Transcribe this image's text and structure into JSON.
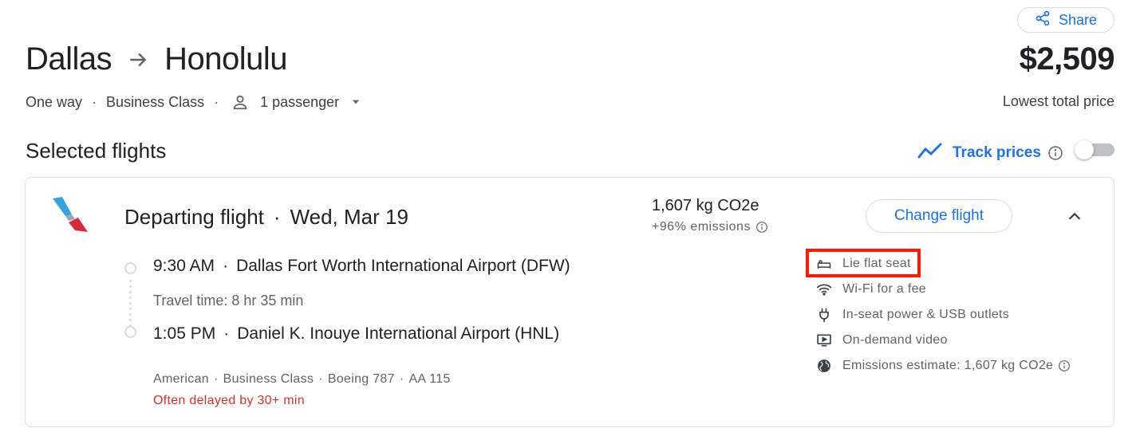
{
  "header": {
    "origin": "Dallas",
    "destination": "Honolulu",
    "share_label": "Share",
    "price": "$2,509",
    "price_caption": "Lowest total price",
    "trip_type": "One way",
    "cabin_class": "Business Class",
    "passengers": "1 passenger"
  },
  "selected": {
    "title": "Selected flights",
    "track_prices_label": "Track prices",
    "track_prices_enabled": false
  },
  "flight": {
    "direction": "Departing flight",
    "date": "Wed, Mar 19",
    "emissions_amount": "1,607 kg CO2e",
    "emissions_delta": "+96% emissions",
    "change_label": "Change flight",
    "departure_time": "9:30 AM",
    "departure_airport": "Dallas Fort Worth International Airport (DFW)",
    "travel_time": "Travel time: 8 hr 35 min",
    "arrival_time": "1:05 PM",
    "arrival_airport": "Daniel K. Inouye International Airport (HNL)",
    "airline": "American",
    "cabin": "Business Class",
    "aircraft": "Boeing 787",
    "flight_number": "AA 115",
    "delay_note": "Often delayed by 30+ min",
    "amenities": [
      {
        "icon": "lie-flat-seat-icon",
        "label": "Lie flat seat"
      },
      {
        "icon": "wifi-icon",
        "label": "Wi-Fi for a fee"
      },
      {
        "icon": "power-plug-icon",
        "label": "In-seat power & USB outlets"
      },
      {
        "icon": "video-icon",
        "label": "On-demand video"
      },
      {
        "icon": "globe-icon",
        "label": "Emissions estimate: 1,607 kg CO2e"
      }
    ]
  },
  "colors": {
    "accent": "#1a73e8",
    "text": "#202124",
    "muted": "#5f6368",
    "warning": "#d93025",
    "highlight": "#ff1a00"
  }
}
